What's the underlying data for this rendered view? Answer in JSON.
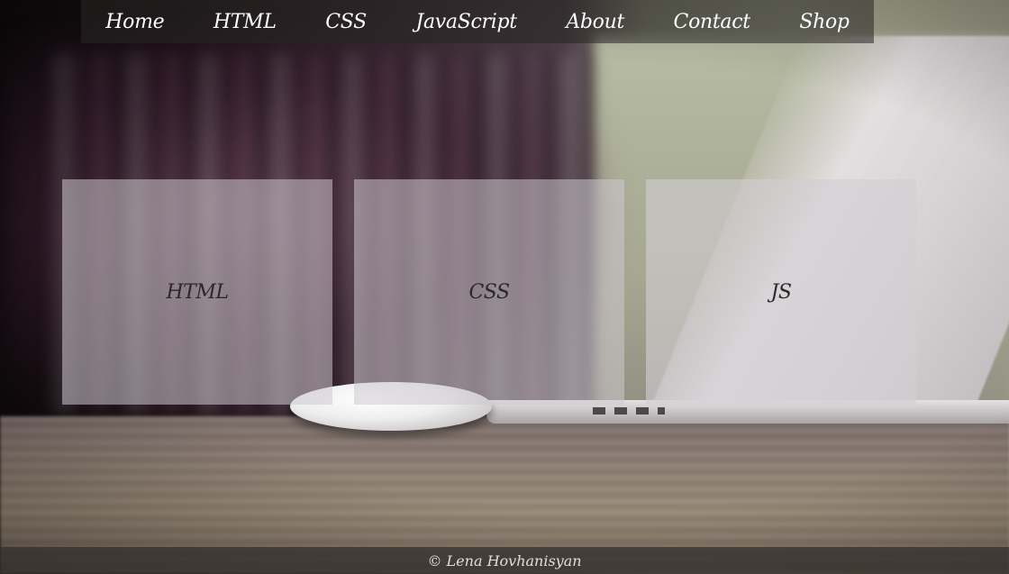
{
  "nav": {
    "items": [
      {
        "label": "Home"
      },
      {
        "label": "HTML"
      },
      {
        "label": "CSS"
      },
      {
        "label": "JavaScript"
      },
      {
        "label": "About"
      },
      {
        "label": "Contact"
      },
      {
        "label": "Shop"
      }
    ]
  },
  "cards": [
    {
      "label": "HTML"
    },
    {
      "label": "CSS"
    },
    {
      "label": "JS"
    }
  ],
  "footer": {
    "text": "© Lena Hovhanisyan"
  },
  "colors": {
    "nav_text": "#ffffff",
    "card_text": "#2b2829",
    "footer_text": "#e4dcd8"
  }
}
